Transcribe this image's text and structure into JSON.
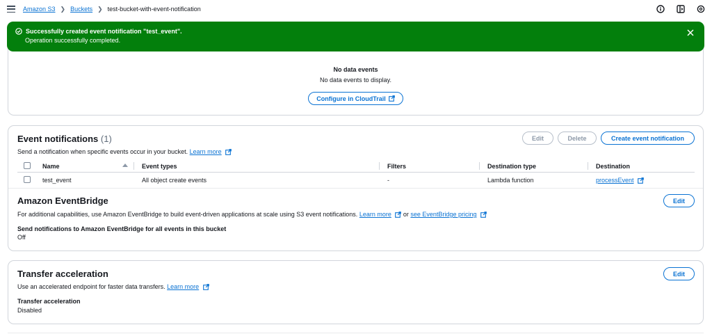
{
  "breadcrumb": {
    "items": [
      "Amazon S3",
      "Buckets"
    ],
    "current": "test-bucket-with-event-notification"
  },
  "flash": {
    "title": "Successfully created event notification \"test_event\".",
    "message": "Operation successfully completed."
  },
  "data_events": {
    "empty_title": "No data events",
    "empty_message": "No data events to display.",
    "configure_label": "Configure in CloudTrail"
  },
  "event_notifications": {
    "title": "Event notifications",
    "count": "(1)",
    "description": "Send a notification when specific events occur in your bucket.",
    "learn_more": "Learn more",
    "edit_label": "Edit",
    "delete_label": "Delete",
    "create_label": "Create event notification",
    "columns": [
      "Name",
      "Event types",
      "Filters",
      "Destination type",
      "Destination"
    ],
    "rows": [
      {
        "name": "test_event",
        "event_types": "All object create events",
        "filters": "-",
        "destination_type": "Lambda function",
        "destination": "processEvent"
      }
    ]
  },
  "eventbridge": {
    "title": "Amazon EventBridge",
    "description": "For additional capabilities, use Amazon EventBridge to build event-driven applications at scale using S3 event notifications.",
    "learn_more": "Learn more",
    "or_text": "or",
    "pricing_link": "see EventBridge pricing",
    "edit_label": "Edit",
    "setting_label": "Send notifications to Amazon EventBridge for all events in this bucket",
    "setting_value": "Off"
  },
  "transfer_acceleration": {
    "title": "Transfer acceleration",
    "description": "Use an accelerated endpoint for faster data transfers.",
    "learn_more": "Learn more",
    "edit_label": "Edit",
    "setting_label": "Transfer acceleration",
    "setting_value": "Disabled"
  },
  "colors": {
    "accent": "#0972d3",
    "success": "#037f0c",
    "border": "#d1d5db"
  },
  "icons": [
    "menu-icon",
    "info-icon",
    "panel-icon",
    "settings-icon",
    "success-icon",
    "close-icon",
    "external-link-icon"
  ]
}
